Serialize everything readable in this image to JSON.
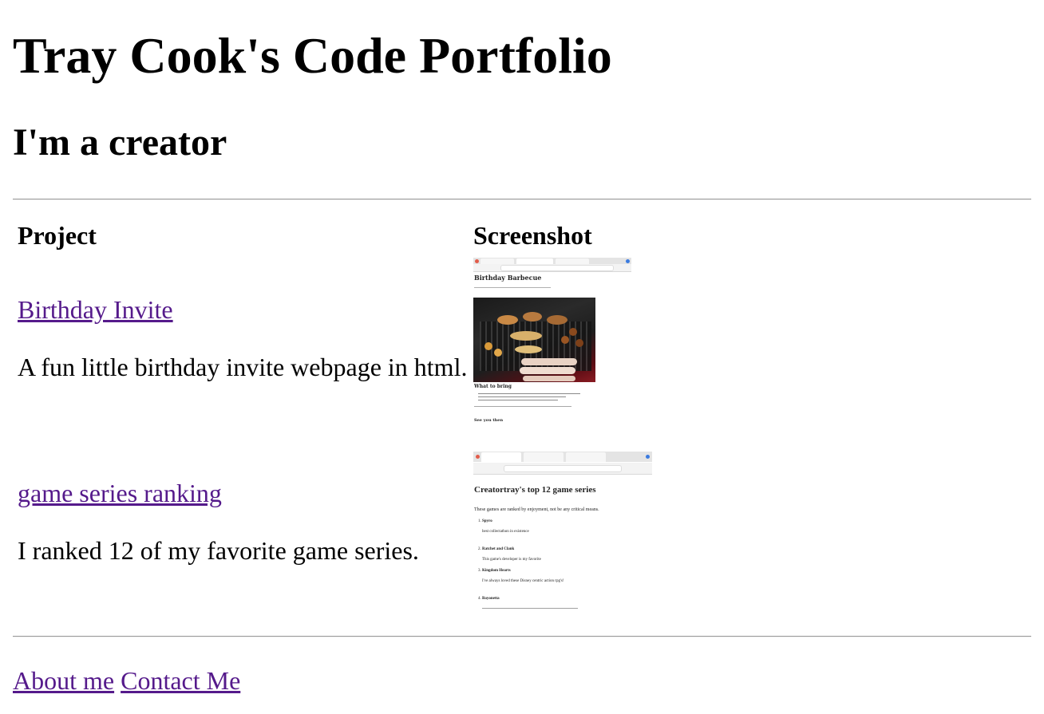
{
  "header": {
    "title": "Tray Cook's Code Portfolio",
    "subtitle": "I'm a creator"
  },
  "table": {
    "col_project": "Project",
    "col_screenshot": "Screenshot",
    "rows": [
      {
        "link": "Birthday Invite",
        "description": "A fun little birthday invite webpage in html.",
        "screenshot": {
          "page_title": "Birthday Barbecue",
          "section_heading": "What to bring",
          "closing": "See you then"
        }
      },
      {
        "link": "game series ranking",
        "description": "I ranked 12 of my favorite game series.",
        "screenshot": {
          "page_title": "Creatortray's top 12 game series",
          "intro": "These games are ranked by enjoyment, not be any critical means.",
          "items": [
            {
              "n": "1.",
              "name": "Spyro",
              "note": "best collectathon in existence"
            },
            {
              "n": "2.",
              "name": "Ratchet and Clank",
              "note": "This game's developer is my favorite"
            },
            {
              "n": "3.",
              "name": "Kingdom Hearts",
              "note": "I've always loved these Disney centric action rpg's!"
            },
            {
              "n": "4.",
              "name": "Bayonetta",
              "note": ""
            }
          ]
        }
      }
    ]
  },
  "footer": {
    "about": "About me",
    "contact": "Contact Me"
  },
  "colors": {
    "link_visited": "#551a8b",
    "rule": "#9a9a9a"
  }
}
